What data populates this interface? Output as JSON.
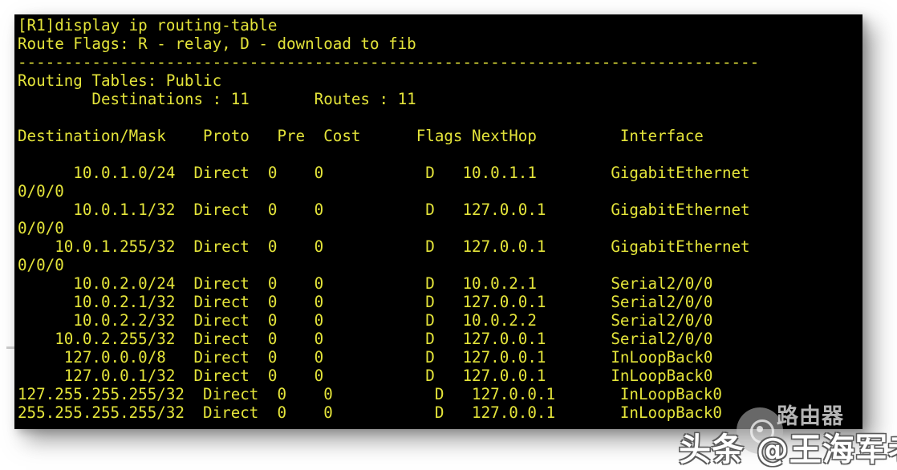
{
  "terminal": {
    "prompt_line": "[R1]display ip routing-table",
    "flags_legend": "Route Flags: R - relay, D - download to fib",
    "separator": "--------------------------------------------------------------------------------",
    "tables_label": "Routing Tables: Public",
    "summary": "        Destinations : 11       Routes : 11",
    "blank": "",
    "column_header": "Destination/Mask    Proto   Pre  Cost      Flags NextHop         Interface",
    "rows": [
      "      10.0.1.0/24  Direct  0    0           D   10.0.1.1        GigabitEthernet",
      "0/0/0",
      "      10.0.1.1/32  Direct  0    0           D   127.0.0.1       GigabitEthernet",
      "0/0/0",
      "    10.0.1.255/32  Direct  0    0           D   127.0.0.1       GigabitEthernet",
      "0/0/0",
      "      10.0.2.0/24  Direct  0    0           D   10.0.2.1        Serial2/0/0",
      "      10.0.2.1/32  Direct  0    0           D   127.0.0.1       Serial2/0/0",
      "      10.0.2.2/32  Direct  0    0           D   10.0.2.2        Serial2/0/0",
      "    10.0.2.255/32  Direct  0    0           D   127.0.0.1       Serial2/0/0",
      "     127.0.0.0/8   Direct  0    0           D   127.0.0.1       InLoopBack0",
      "     127.0.0.1/32  Direct  0    0           D   127.0.0.1       InLoopBack0",
      "127.255.255.255/32  Direct  0    0           D   127.0.0.1       InLoopBack0",
      "255.255.255.255/32  Direct  0    0           D   127.0.0.1       InLoopBack0"
    ],
    "colors": {
      "background": "#000000",
      "text": "#e4e43a"
    }
  },
  "watermarks": {
    "router_label": "路由器",
    "author_label": "头条 @王海军老师"
  }
}
